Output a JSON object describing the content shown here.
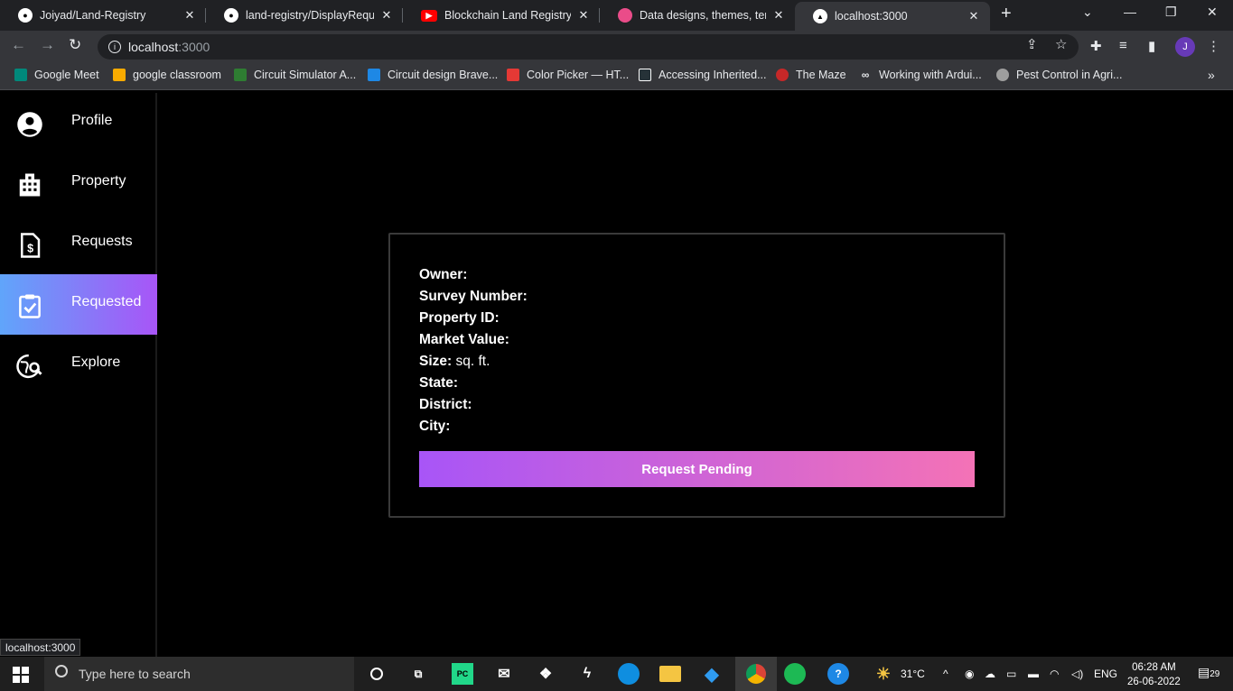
{
  "browser": {
    "tabs": [
      {
        "title": "Joiyad/Land-Registry",
        "icon": "github-icon"
      },
      {
        "title": "land-registry/DisplayRequest",
        "icon": "github-icon"
      },
      {
        "title": "Blockchain Land Registry Proj",
        "icon": "youtube-icon"
      },
      {
        "title": "Data designs, themes, templ",
        "icon": "dribbble-icon"
      },
      {
        "title": "localhost:3000",
        "icon": "nextjs-icon"
      }
    ],
    "address": {
      "host": "localhost",
      "port": ":3000"
    },
    "profile_initial": "J",
    "bookmarks": [
      {
        "label": "Google Meet",
        "color": "#00897b"
      },
      {
        "label": "google classroom",
        "color": "#f9ab00"
      },
      {
        "label": "Circuit Simulator A...",
        "color": "#2e7d32"
      },
      {
        "label": "Circuit design Brave...",
        "color": "#1e88e5"
      },
      {
        "label": "Color Picker — HT...",
        "color": "#e53935"
      },
      {
        "label": "Accessing Inherited...",
        "color": "#263238"
      },
      {
        "label": "The Maze",
        "color": "#c62828"
      },
      {
        "label": "Working with Ardui...",
        "color": "#e8eaed"
      },
      {
        "label": "Pest Control in Agri...",
        "color": "#9e9e9e"
      }
    ],
    "status_url": "localhost:3000"
  },
  "sidebar": {
    "items": [
      {
        "label": "Profile",
        "icon": "account-circle-icon"
      },
      {
        "label": "Property",
        "icon": "building-icon"
      },
      {
        "label": "Requests",
        "icon": "invoice-dollar-icon"
      },
      {
        "label": "Requested",
        "icon": "clipboard-check-icon",
        "active": true
      },
      {
        "label": "Explore",
        "icon": "globe-search-icon"
      }
    ],
    "active_gradient": [
      "#60a5fa",
      "#a855f7"
    ]
  },
  "card": {
    "fields": [
      {
        "label": "Owner:",
        "value": ""
      },
      {
        "label": "Survey Number:",
        "value": ""
      },
      {
        "label": "Property ID:",
        "value": ""
      },
      {
        "label": "Market Value:",
        "value": ""
      },
      {
        "label": "Size:",
        "value": "sq. ft."
      },
      {
        "label": "State:",
        "value": ""
      },
      {
        "label": "District:",
        "value": ""
      },
      {
        "label": "City:",
        "value": ""
      }
    ],
    "button_label": "Request Pending",
    "button_gradient": [
      "#a855f7",
      "#f472b6"
    ]
  },
  "taskbar": {
    "search_placeholder": "Type here to search",
    "weather": "31°C",
    "language": "ENG",
    "time": "06:28 AM",
    "date": "26-06-2022",
    "notifications": "29"
  }
}
